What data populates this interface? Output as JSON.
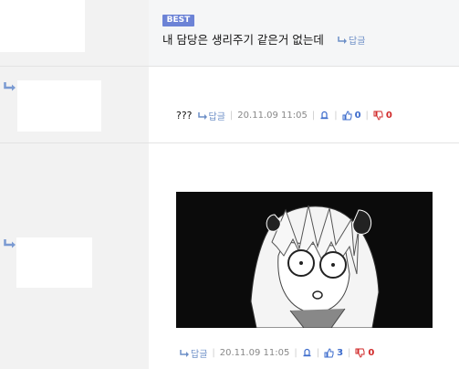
{
  "comments": [
    {
      "badge": "BEST",
      "text": "내 담당은 생리주기 같은거 없는데",
      "reply_label": "답글"
    },
    {
      "text": "???",
      "reply_label": "답글",
      "date": "20.11.09 11:05",
      "upvotes": "0",
      "downvotes": "0"
    },
    {
      "reply_label": "답글",
      "date": "20.11.09 11:05",
      "upvotes": "3",
      "downvotes": "0",
      "image_icon": "anime-girl-manga-image"
    }
  ],
  "colors": {
    "badge": "#6c83d6",
    "reply": "#6d8fc7",
    "upvote": "#3d6ccc",
    "downvote": "#d12a2a"
  }
}
